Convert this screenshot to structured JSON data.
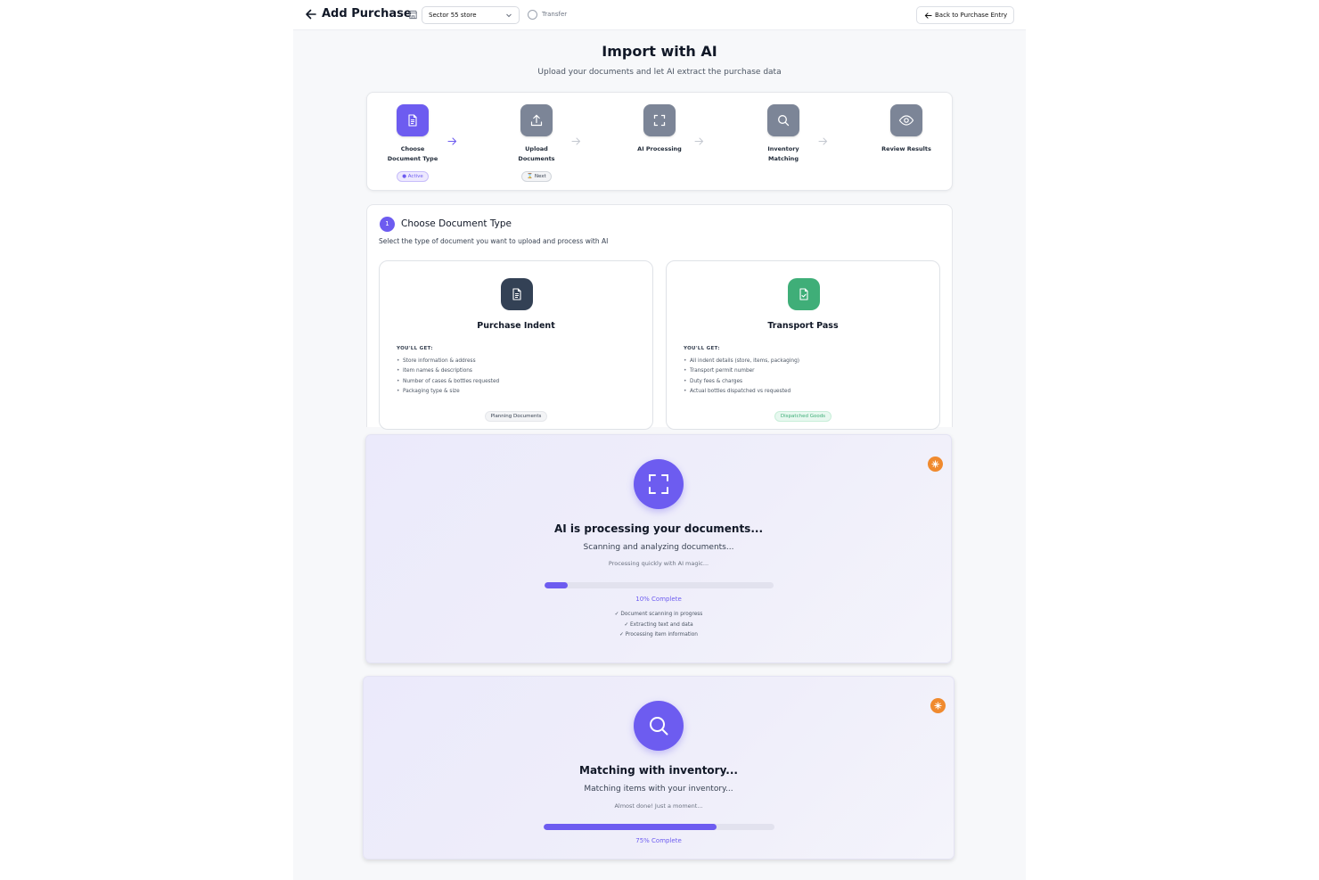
{
  "header": {
    "title": "Add Purchase",
    "store_select": "Sector 55 store",
    "transfer_label": "Transfer",
    "back_button": "Back to Purchase Entry"
  },
  "hero": {
    "title": "Import with AI",
    "subtitle": "Upload your documents and let AI extract the purchase data"
  },
  "steps": [
    {
      "label_line1": "Choose",
      "label_line2": "Document Type",
      "badge": "● Active",
      "icon": "document-icon",
      "state": "active"
    },
    {
      "label_line1": "Upload",
      "label_line2": "Documents",
      "badge": "⌛ Next",
      "icon": "upload-icon",
      "state": "next"
    },
    {
      "label_line1": "AI Processing",
      "label_line2": "",
      "badge": "",
      "icon": "scan-icon",
      "state": "pending"
    },
    {
      "label_line1": "Inventory",
      "label_line2": "Matching",
      "badge": "",
      "icon": "search-icon",
      "state": "pending"
    },
    {
      "label_line1": "Review Results",
      "label_line2": "",
      "badge": "",
      "icon": "eye-icon",
      "state": "pending"
    }
  ],
  "choose": {
    "step_number": "1",
    "title": "Choose Document Type",
    "subtitle": "Select the type of document you want to upload and process with AI",
    "options": [
      {
        "name": "Purchase Indent",
        "gets_label": "YOU'LL GET:",
        "items": [
          "Store information & address",
          "Item names & descriptions",
          "Number of cases & bottles requested",
          "Packaging type & size"
        ],
        "tag": "Planning Documents",
        "icon_color": "#334155",
        "icon": "document-icon"
      },
      {
        "name": "Transport Pass",
        "gets_label": "YOU'LL GET:",
        "items": [
          "All indent details (store, items, packaging)",
          "Transport permit number",
          "Duty fees & charges",
          "Actual bottles dispatched vs requested"
        ],
        "tag": "Dispatched Goods",
        "icon_color": "#3fae78",
        "icon": "document-check-icon"
      }
    ]
  },
  "processing": {
    "title": "AI is processing your documents...",
    "subtitle": "Scanning and analyzing documents...",
    "note": "Processing quickly with AI magic...",
    "progress": 10,
    "progress_label": "10% Complete",
    "checks": [
      "✓ Document scanning in progress",
      "✓ Extracting text and data",
      "✓ Processing item information"
    ]
  },
  "matching": {
    "title": "Matching with inventory...",
    "subtitle": "Matching items with your inventory...",
    "note": "Almost done! Just a moment...",
    "progress": 75,
    "progress_label": "75% Complete"
  },
  "colors": {
    "accent": "#6d5cf0",
    "step_inactive": "#7c8597",
    "spark": "#f08a2e"
  }
}
